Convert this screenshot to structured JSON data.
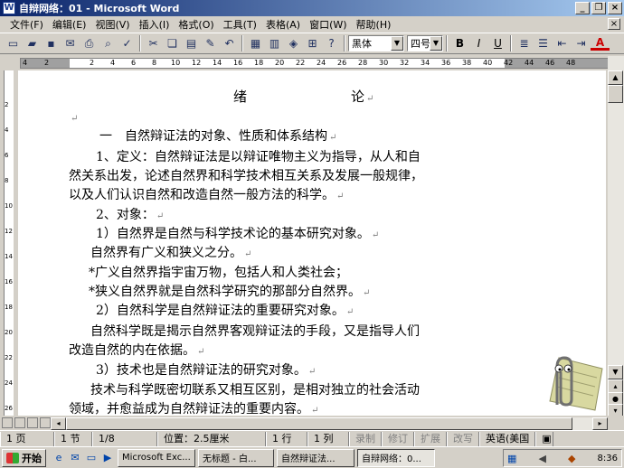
{
  "window": {
    "title": "自辩网络：01 - Microsoft Word",
    "app_icon": "W",
    "buttons": [
      "_",
      "❐",
      "×"
    ]
  },
  "menubar": {
    "items": [
      "文件(F)",
      "编辑(E)",
      "视图(V)",
      "插入(I)",
      "格式(O)",
      "工具(T)",
      "表格(A)",
      "窗口(W)",
      "帮助(H)"
    ],
    "close_doc": "×"
  },
  "toolbar": {
    "font_name": "黑体",
    "font_size": "四号",
    "bold": "B",
    "italic": "I",
    "underline": "U",
    "font_color_letter": "A"
  },
  "ruler": {
    "numbers": [
      "4",
      "2",
      "2",
      "4",
      "6",
      "8",
      "10",
      "12",
      "14",
      "16",
      "18",
      "20",
      "22",
      "24",
      "26",
      "28",
      "30",
      "32",
      "34",
      "36",
      "38",
      "40",
      "42",
      "44",
      "46",
      "48"
    ]
  },
  "vruler": {
    "numbers": [
      "2",
      "4",
      "6",
      "8",
      "10",
      "12",
      "14",
      "16",
      "18",
      "20",
      "22",
      "24",
      "26"
    ]
  },
  "document": {
    "heading_left": "绪",
    "heading_right": "论",
    "lines": [
      "一　自然辩证法的对象、性质和体系结构",
      "1、定义：自然辩证法是以辩证唯物主义为指导，从人和自",
      "然关系出发，论述自然界和科学技术相互关系及发展一般规律，",
      "以及人们认识自然和改造自然一般方法的科学。",
      "2、对象：",
      "1）自然界是自然与科学技术论的基本研究对象。",
      "自然界有广义和狭义之分。",
      "*广义自然界指宇宙万物，包括人和人类社会；",
      "*狭义自然界就是自然科学研究的那部分自然界。",
      "2）自然科学是自然辩证法的重要研究对象。",
      "自然科学既是揭示自然界客观辩证法的手段，又是指导人们",
      "改造自然的内在依据。",
      "3）技术也是自然辩证法的研究对象。",
      "技术与科学既密切联系又相互区别，是相对独立的社会活动",
      "领域，并愈益成为自然辩证法的重要内容。"
    ],
    "para_mark": "↵"
  },
  "statusbar": {
    "page": "1 页",
    "section": "1 节",
    "page_of": "1/8",
    "position": "位置：2.5厘米",
    "line": "1 行",
    "column": "1 列",
    "rec": "录制",
    "trk": "修订",
    "ext": "扩展",
    "ovr": "改写",
    "language": "英语(美国"
  },
  "taskbar": {
    "start": "开始",
    "tasks": [
      "Microsoft Exc...",
      "无标题 - 白...",
      "自然辩证法...",
      "自辩网络：0..."
    ],
    "time": "8:36"
  }
}
